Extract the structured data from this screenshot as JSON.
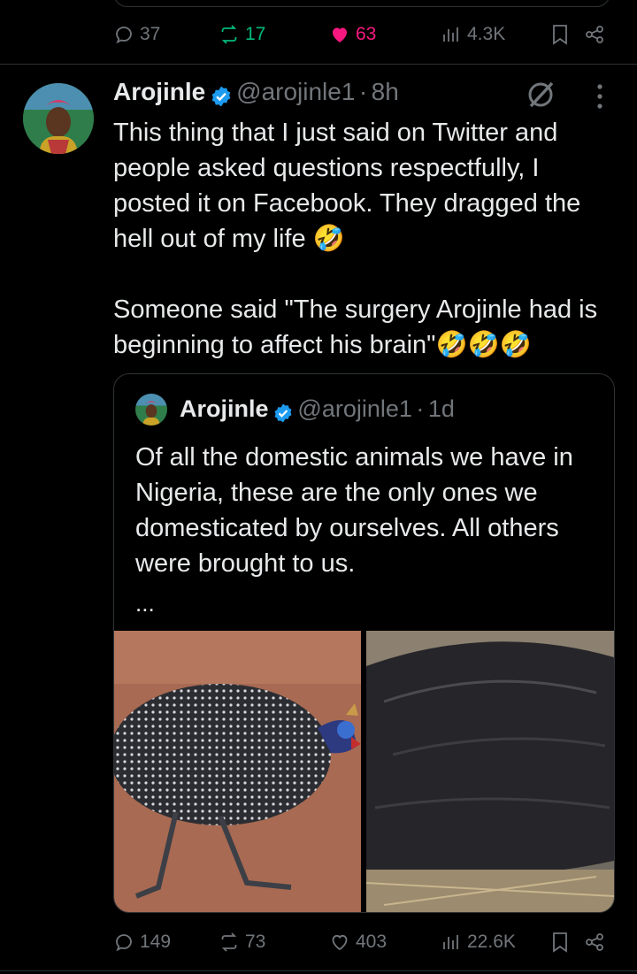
{
  "prev_tweet": {
    "actions": {
      "replies": "37",
      "retweets": "17",
      "likes": "63",
      "views": "4.3K"
    },
    "colors": {
      "retweeted": "#00ba7c",
      "liked": "#f91880"
    }
  },
  "tweet": {
    "author_name": "Arojinle",
    "author_handle": "@arojinle1",
    "time": "8h",
    "text": "This thing that I just said on Twitter and people asked questions respectfully, I posted it on Facebook. They dragged the hell out of my life 🤣\n\nSomeone said \"The surgery Arojinle had is beginning to affect his brain\"🤣🤣🤣",
    "quote": {
      "author_name": "Arojinle",
      "author_handle": "@arojinle1",
      "time": "1d",
      "text": "Of all the domestic animals we have in Nigeria, these are the only ones we domesticated by ourselves. All others were brought to us.",
      "more": "...",
      "images": [
        "guinea fowl",
        "grasscutter"
      ]
    },
    "actions": {
      "replies": "149",
      "retweets": "73",
      "likes": "403",
      "views": "22.6K"
    }
  },
  "colors": {
    "background": "#000000",
    "text": "#e7e9ea",
    "muted": "#71767b",
    "verified": "#1d9bf0",
    "border": "#2f3336"
  }
}
